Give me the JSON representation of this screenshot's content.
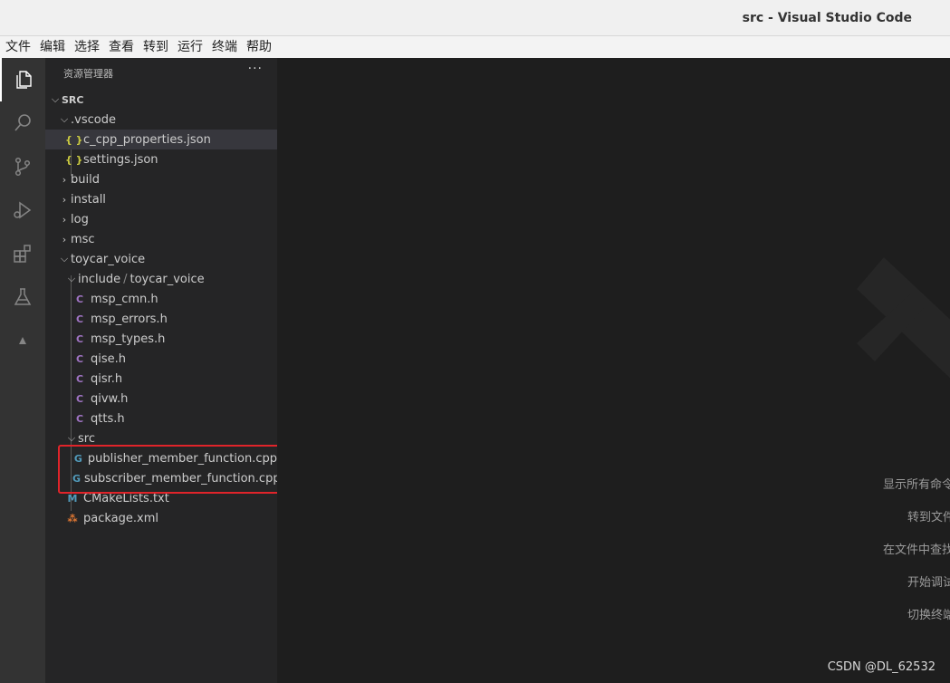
{
  "window": {
    "title": "src - Visual Studio Code"
  },
  "menu": [
    "文件",
    "编辑",
    "选择",
    "查看",
    "转到",
    "运行",
    "终端",
    "帮助"
  ],
  "activity": [
    "explorer-icon",
    "search-icon",
    "source-control-icon",
    "run-debug-icon",
    "extensions-icon",
    "testing-icon",
    "ros-icon"
  ],
  "sidebar": {
    "header": "资源管理器",
    "more": "···",
    "root": "SRC",
    "items": [
      {
        "label": ".vscode",
        "expanded": true
      },
      {
        "label": "c_cpp_properties.json",
        "icon": "{ }"
      },
      {
        "label": "settings.json",
        "icon": "{ }"
      },
      {
        "label": "build"
      },
      {
        "label": "install"
      },
      {
        "label": "log"
      },
      {
        "label": "msc"
      },
      {
        "label": "toycar_voice",
        "expanded": true
      },
      {
        "label": "include",
        "label2": "toycar_voice",
        "sep": "/",
        "expanded": true
      },
      {
        "label": "msp_cmn.h",
        "icon": "C"
      },
      {
        "label": "msp_errors.h",
        "icon": "C"
      },
      {
        "label": "msp_types.h",
        "icon": "C"
      },
      {
        "label": "qise.h",
        "icon": "C"
      },
      {
        "label": "qisr.h",
        "icon": "C"
      },
      {
        "label": "qivw.h",
        "icon": "C"
      },
      {
        "label": "qtts.h",
        "icon": "C"
      },
      {
        "label": "src",
        "expanded": true
      },
      {
        "label": "publisher_member_function.cpp",
        "icon": "G"
      },
      {
        "label": "subscriber_member_function.cpp",
        "icon": "G"
      },
      {
        "label": "CMakeLists.txt",
        "icon": "M"
      },
      {
        "label": "package.xml",
        "icon": "⁂"
      }
    ]
  },
  "editor": {
    "hints": [
      "显示所有命令",
      "转到文件",
      "在文件中查找",
      "开始调试",
      "切换终端"
    ],
    "watermark": "CSDN @DL_62532"
  },
  "colors": {
    "activitybar": "#333333",
    "sidebar": "#252526",
    "editor": "#1e1e1e",
    "highlight": "#e0242a"
  }
}
